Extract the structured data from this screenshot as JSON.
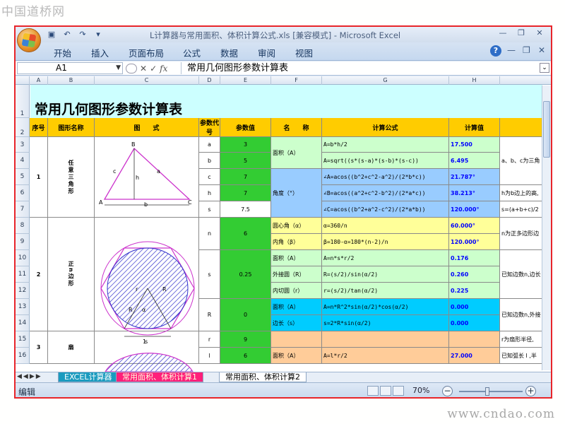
{
  "watermarks": {
    "top": "中国道桥网",
    "bottom": "www.cndao.com"
  },
  "window": {
    "title": "L计算器与常用面积、体积计算公式.xls [兼容模式] - Microsoft Excel"
  },
  "ribbon": {
    "tabs": [
      "开始",
      "插入",
      "页面布局",
      "公式",
      "数据",
      "审阅",
      "视图"
    ]
  },
  "formula_bar": {
    "name_box": "A1",
    "content": "常用几何图形参数计算表",
    "fx": "fx"
  },
  "columns": [
    "A",
    "B",
    "C",
    "D",
    "E",
    "F",
    "G",
    "H"
  ],
  "sheet_title": "常用几何图形参数计算表",
  "header": {
    "no": "序号",
    "shape": "图形名称",
    "figure": "图　　式",
    "code": "参数代号",
    "param": "参数值",
    "name": "名　　称",
    "formula": "计算公式",
    "value": "计算值"
  },
  "rows": {
    "r3": {
      "no": "1",
      "shape": "任意三角形",
      "code": "a",
      "param": "3",
      "name": "面积（A）",
      "formula": "A=b*h/2",
      "value": "17.500",
      "note": "a、b、c为三角"
    },
    "r4": {
      "code": "b",
      "param": "5",
      "formula": "A=sqrt((s*(s-a)*(s-b)*(s-c))",
      "value": "6.495"
    },
    "r5": {
      "code": "c",
      "param": "7",
      "name": "角度（°）",
      "formula": "∠A=acos((b^2+c^2-a^2)/(2*b*c))",
      "value": "21.787°"
    },
    "r6": {
      "code": "h",
      "param": "7",
      "formula": "∠B=acos((a^2+c^2-b^2)/(2*a*c))",
      "value": "38.213°",
      "note": "h为b边上的高,"
    },
    "r7": {
      "code": "s",
      "param": "7.5",
      "formula": "∠C=acos((b^2+a^2-c^2)/(2*a*b))",
      "value": "120.000°",
      "note": "s=(a+b+c)/2"
    },
    "r8": {
      "no": "2",
      "shape": "正n边形",
      "code": "n",
      "param": "6",
      "name": "圆心角（α）",
      "formula": "α=360/n",
      "value": "60.000°",
      "note": "n为正多边形边"
    },
    "r9": {
      "name": "内角（β）",
      "formula": "β=180-α=180*(n-2)/n",
      "value": "120.000°"
    },
    "r10": {
      "code": "s",
      "param": "0.25",
      "name": "面积（A）",
      "formula": "A=n*s*r/2",
      "value": "0.176",
      "note": "已知边数n,边长"
    },
    "r11": {
      "name": "外接圆（R）",
      "formula": "R=(s/2)/sin(α/2)",
      "value": "0.260"
    },
    "r12": {
      "name": "内切圆（r）",
      "formula": "r=(s/2)/tan(α/2)",
      "value": "0.225"
    },
    "r13": {
      "code": "R",
      "param": "0",
      "name": "面积（A）",
      "formula": "A=n*R^2*sin(α/2)*cos(α/2)",
      "value": "0.000",
      "note": "已知边数n,外接"
    },
    "r14": {
      "name": "边长（s）",
      "formula": "s=2*R*sin(α/2)",
      "value": "0.000"
    },
    "r15": {
      "no": "3",
      "shape": "扇",
      "code": "r",
      "param": "9",
      "note": "r为扇形半径,"
    },
    "r16": {
      "code": "l",
      "param": "6",
      "name": "面积（A）",
      "formula": "A=l*r/2",
      "value": "27.000",
      "note": "已知弧长 l ,半"
    }
  },
  "figure_labels": {
    "triangle": {
      "a": "a",
      "b": "b",
      "c": "c",
      "h": "h",
      "A": "A",
      "B": "B",
      "C": "C"
    },
    "polygon": {
      "r": "r",
      "R": "R",
      "alpha": "α",
      "s": "s"
    },
    "sector": {
      "l": "1"
    }
  },
  "sheet_tabs": [
    "EXCEL计算器",
    "常用面积、体积计算1",
    "常用面积、体积计算2"
  ],
  "status": {
    "ready": "编辑",
    "zoom": "70%"
  },
  "colors": {
    "title_bg": "#ccffff",
    "header_bg": "#ffcc00",
    "param_bg": "#33cc33",
    "blue_bg": "#99ccff",
    "peach_bg": "#ffcc99",
    "yellow_bg": "#ffff99",
    "green_bg": "#ccffcc",
    "cyan_bg": "#00ccff",
    "value_blue": "#0000ff",
    "frame_red": "#e8252a"
  }
}
